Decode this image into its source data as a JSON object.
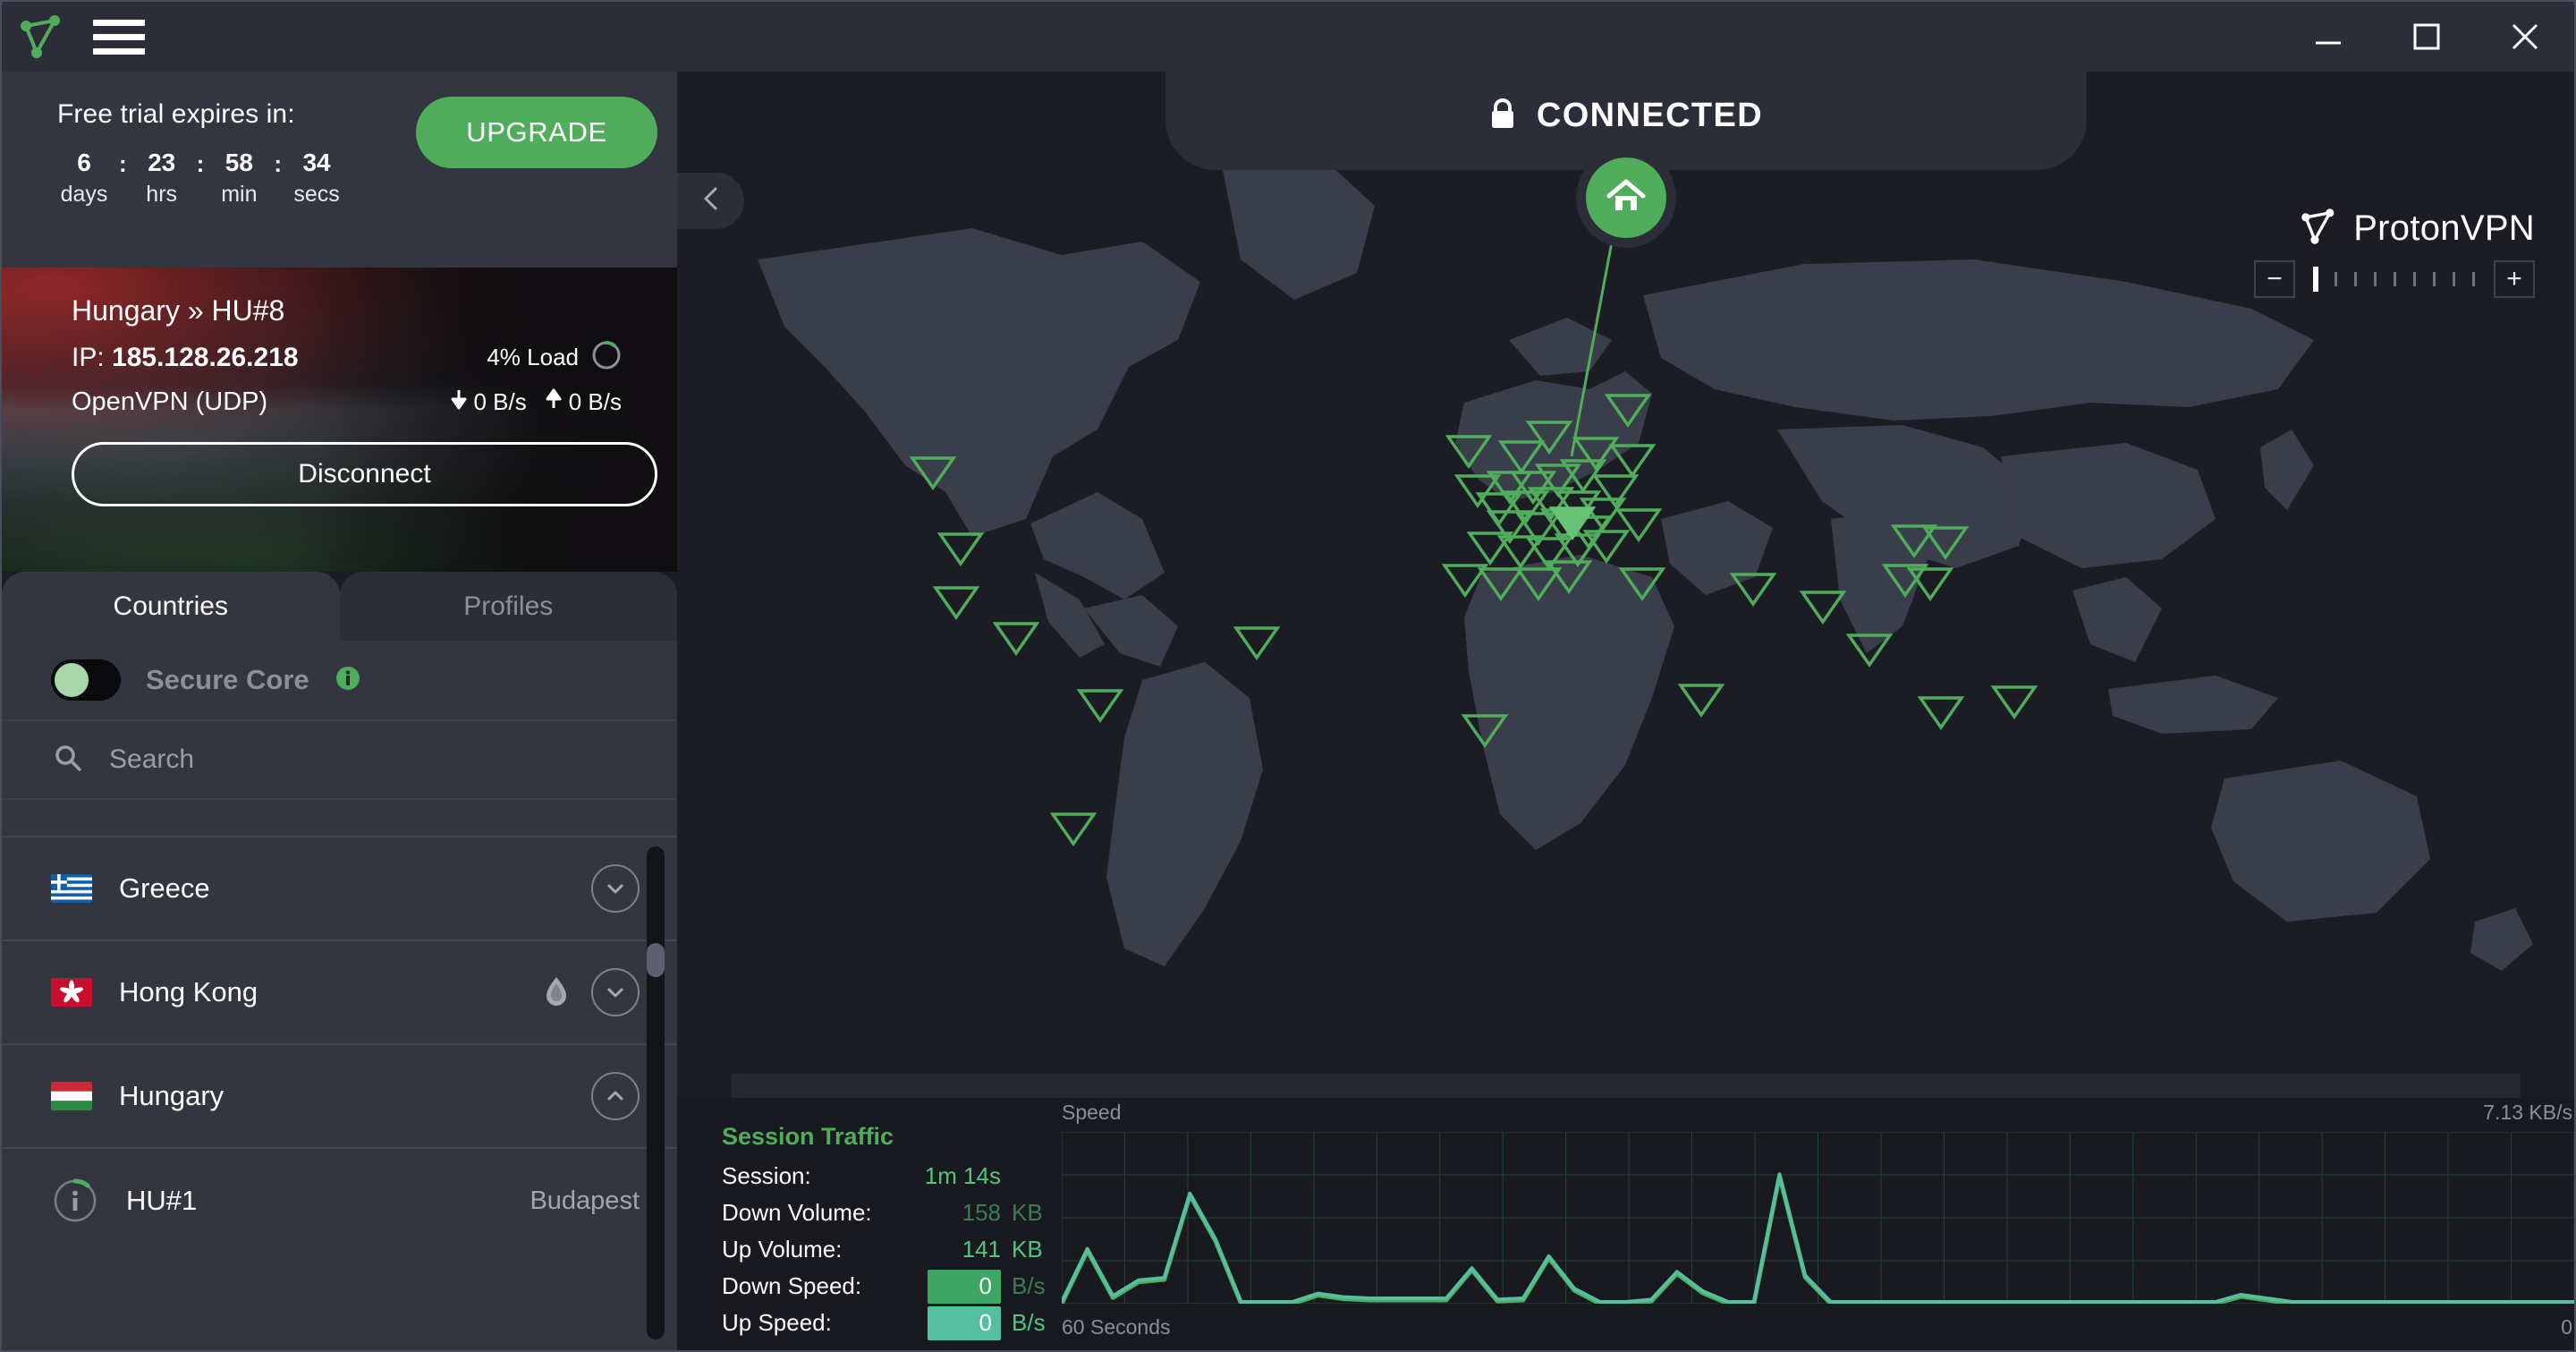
{
  "titlebar": {
    "logo_icon": "protonvpn-logo-icon",
    "menu_icon": "hamburger-menu-icon",
    "minimize_icon": "minimize-icon",
    "maximize_icon": "maximize-icon",
    "close_icon": "close-icon"
  },
  "trial": {
    "title": "Free trial expires in:",
    "units": [
      {
        "value": "6",
        "label": "days"
      },
      {
        "value": "23",
        "label": "hrs"
      },
      {
        "value": "58",
        "label": "min"
      },
      {
        "value": "34",
        "label": "secs"
      }
    ],
    "separator": ":",
    "upgrade_label": "UPGRADE"
  },
  "connection": {
    "server": "Hungary » HU#8",
    "ip_label": "IP:",
    "ip_value": "185.128.26.218",
    "load": "4% Load",
    "protocol": "OpenVPN (UDP)",
    "down_speed": "0 B/s",
    "up_speed": "0 B/s",
    "disconnect_label": "Disconnect"
  },
  "tabs": [
    {
      "label": "Countries",
      "active": true
    },
    {
      "label": "Profiles",
      "active": false
    }
  ],
  "secure_core": {
    "label": "Secure Core",
    "enabled": false,
    "info_icon": "info-icon"
  },
  "search": {
    "placeholder": "Search",
    "value": "",
    "icon": "search-icon"
  },
  "countries": [
    {
      "name": "Greece",
      "flag": "gr",
      "expanded": false,
      "tor": false
    },
    {
      "name": "Hong Kong",
      "flag": "hk",
      "expanded": false,
      "tor": true
    },
    {
      "name": "Hungary",
      "flag": "hu",
      "expanded": true,
      "tor": false
    }
  ],
  "servers": [
    {
      "name": "HU#1",
      "city": "Budapest"
    }
  ],
  "map": {
    "status": "CONNECTED",
    "status_lock_icon": "lock-icon",
    "home_icon": "home-icon",
    "collapse_icon": "chevron-left-icon",
    "brand": "ProtonVPN",
    "brand_icon": "protonvpn-logo-icon",
    "zoom_out_label": "−",
    "zoom_in_label": "+",
    "zoom_ticks": 9,
    "zoom_level": 1
  },
  "session_traffic": {
    "title": "Session Traffic",
    "rows": [
      {
        "label": "Session:",
        "value": "1m 14s",
        "unit": "",
        "style": "bright"
      },
      {
        "label": "Down Volume:",
        "value": "158",
        "unit": "KB",
        "style": "dim"
      },
      {
        "label": "Up Volume:",
        "value": "141",
        "unit": "KB",
        "style": "bright"
      },
      {
        "label": "Down Speed:",
        "value": "0",
        "unit": "B/s",
        "style": "badge-down"
      },
      {
        "label": "Up Speed:",
        "value": "0",
        "unit": "B/s",
        "style": "badge-up"
      }
    ]
  },
  "chart_data": {
    "type": "line",
    "title": "",
    "ylabel": "Speed",
    "xlabel": "60 Seconds",
    "x_left_label": "60 Seconds",
    "x_right_label": "0",
    "y_max_label": "7.13  KB/s",
    "ylim": [
      0,
      7.13
    ],
    "grid": true,
    "legend": "none",
    "x": [
      0,
      1,
      2,
      3,
      4,
      5,
      6,
      7,
      8,
      9,
      10,
      11,
      12,
      13,
      14,
      15,
      16,
      17,
      18,
      19,
      20,
      21,
      22,
      23,
      24,
      25,
      26,
      27,
      28,
      29,
      30,
      31,
      32,
      33,
      34,
      35,
      36,
      37,
      38,
      39,
      40,
      41,
      42,
      43,
      44,
      45,
      46,
      47,
      48,
      49,
      50,
      51,
      52,
      53,
      54,
      55,
      56,
      57,
      58,
      59
    ],
    "series": [
      {
        "name": "Down Speed",
        "color": "#4fad5b",
        "values": [
          0,
          2.2,
          0.25,
          0.9,
          1.0,
          4.5,
          2.6,
          0,
          0,
          0,
          0.35,
          0.2,
          0.15,
          0.15,
          0.15,
          0.15,
          1.4,
          0.1,
          0.15,
          1.9,
          0.55,
          0,
          0,
          0.1,
          1.25,
          0.45,
          0,
          0,
          5.3,
          1.1,
          0,
          0,
          0,
          0,
          0,
          0,
          0,
          0,
          0,
          0,
          0,
          0,
          0,
          0,
          0,
          0,
          0.3,
          0.15,
          0,
          0,
          0,
          0,
          0,
          0,
          0,
          0,
          0,
          0,
          0,
          0
        ]
      },
      {
        "name": "Up Speed",
        "color": "#56bfa0",
        "values": [
          0,
          2.2,
          0.25,
          0.9,
          1.0,
          4.5,
          2.6,
          0,
          0,
          0,
          0.35,
          0.2,
          0.15,
          0.15,
          0.15,
          0.15,
          1.4,
          0.1,
          0.15,
          1.9,
          0.55,
          0,
          0,
          0.1,
          1.25,
          0.45,
          0,
          0,
          5.3,
          1.1,
          0,
          0,
          0,
          0,
          0,
          0,
          0,
          0,
          0,
          0,
          0,
          0,
          0,
          0,
          0,
          0,
          0.3,
          0.15,
          0,
          0,
          0,
          0,
          0,
          0,
          0,
          0,
          0,
          0,
          0,
          0
        ]
      }
    ]
  }
}
